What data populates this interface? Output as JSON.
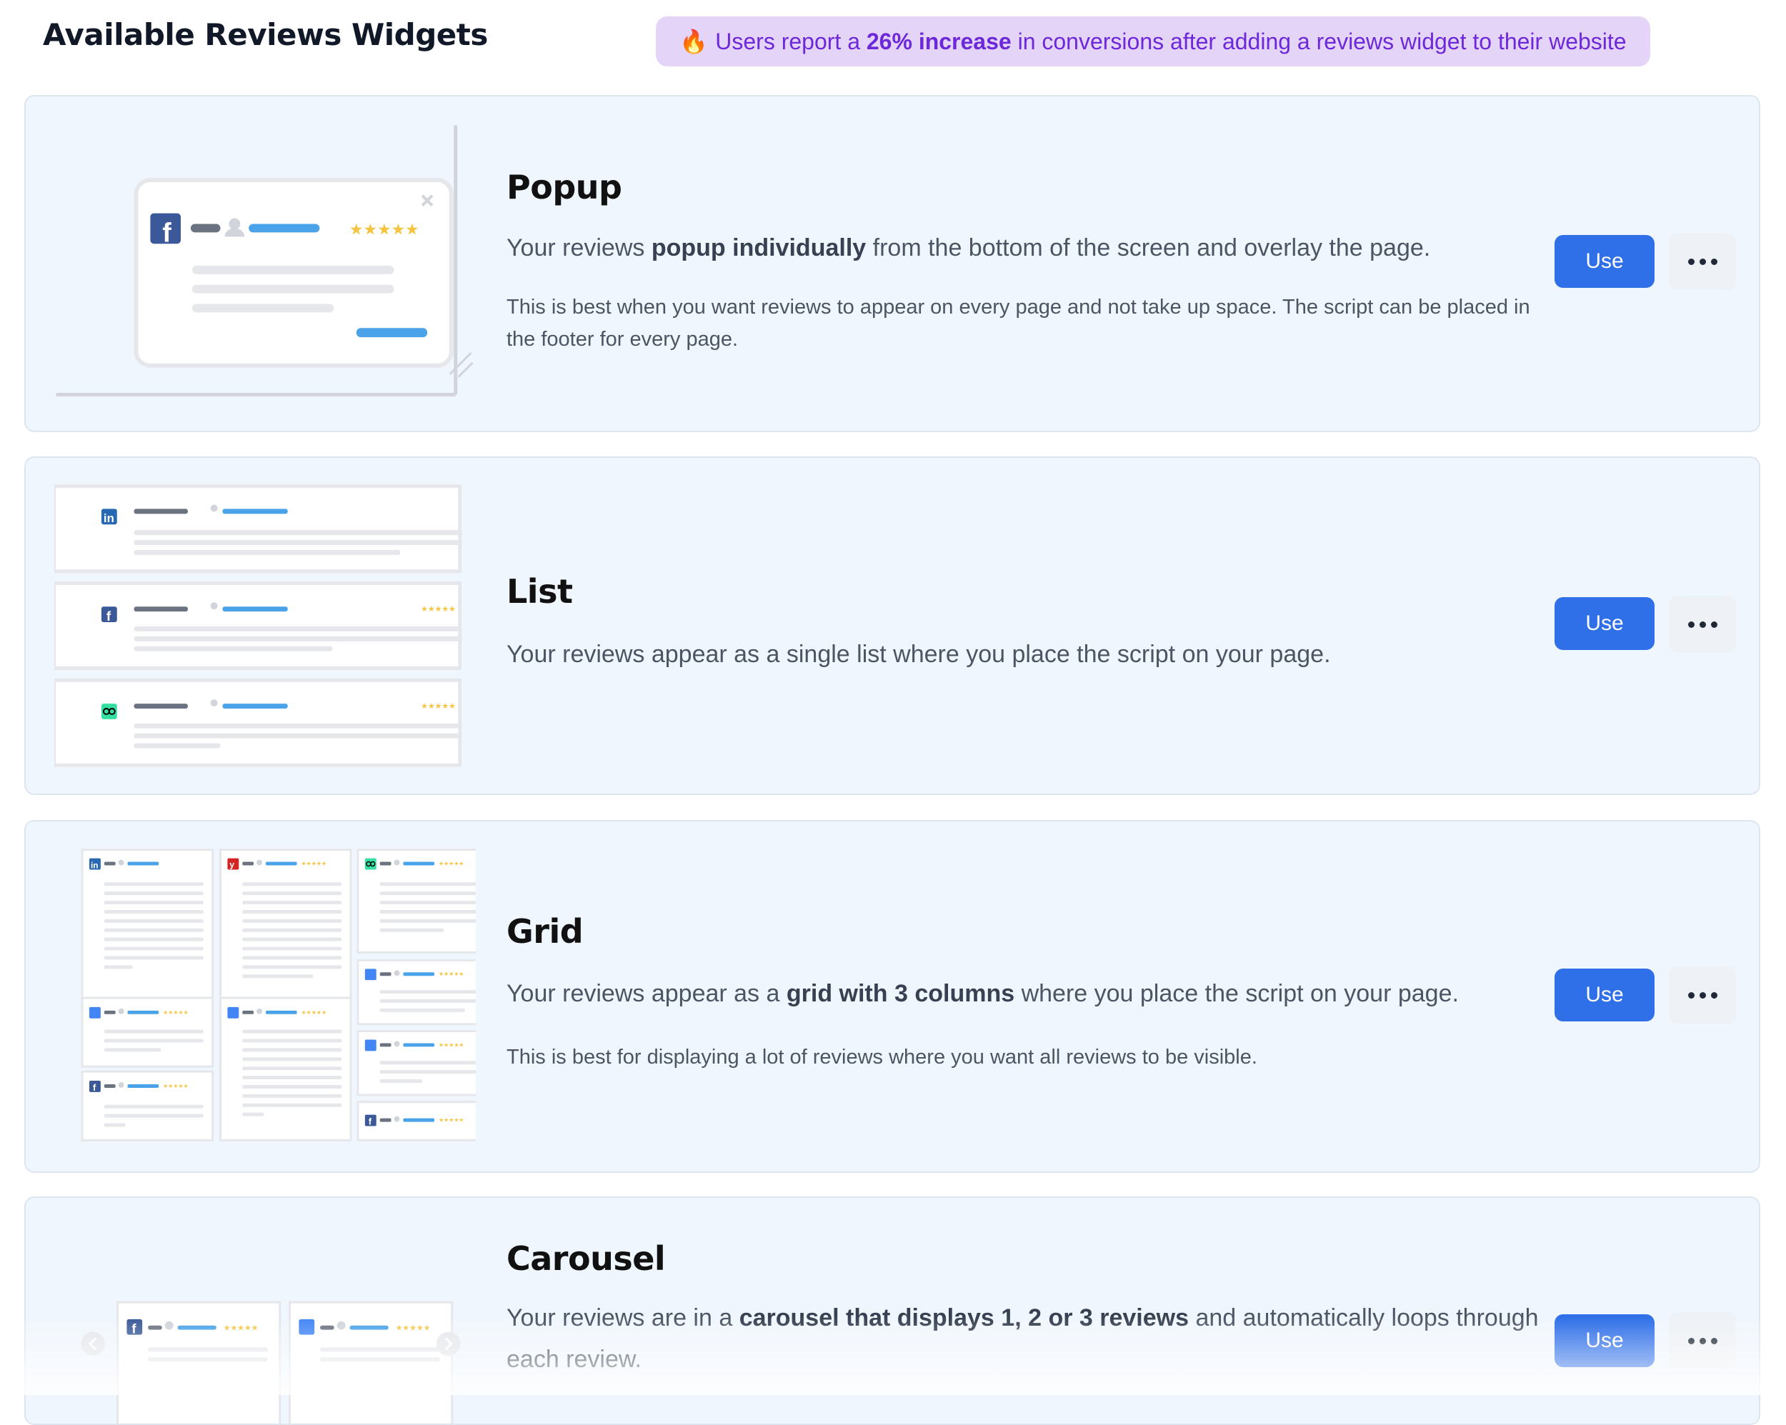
{
  "header": {
    "title": "Available Reviews Widgets",
    "promo": {
      "emoji": "🔥",
      "prefix": "Users report a",
      "highlight": "26% increase",
      "suffix": "in conversions after adding a reviews widget to their website"
    }
  },
  "widgets": [
    {
      "title": "Popup",
      "desc_pre": "Your reviews",
      "desc_bold": "popup individually",
      "desc_post": "from the bottom of the screen and overlay the page.",
      "note": "This is best when you want reviews to appear on every page and not take up space. The script can be placed in the footer for every page.",
      "use_label": "Use"
    },
    {
      "title": "List",
      "desc": "Your reviews appear as a single list where you place the script on your page.",
      "use_label": "Use"
    },
    {
      "title": "Grid",
      "desc_pre": "Your reviews appear as a",
      "desc_bold": "grid with 3 columns",
      "desc_post": "where you place the script on your page.",
      "note": "This is best for displaying a lot of reviews where you want all reviews to be visible.",
      "use_label": "Use"
    },
    {
      "title": "Carousel",
      "desc_pre": "Your reviews are in a",
      "desc_bold": "carousel that displays 1, 2 or 3 reviews",
      "desc_post": "and automatically loops through each review.",
      "use_label": "Use"
    }
  ],
  "icons": {
    "more": "more-horizontal-icon",
    "facebook": "facebook-icon",
    "linkedin": "linkedin-icon",
    "tripadvisor": "tripadvisor-icon",
    "yelp": "yelp-icon",
    "google-business": "google-business-icon",
    "user": "user-avatar-icon",
    "close": "close-icon",
    "resize": "resize-handle-icon",
    "chevron-left": "chevron-left-icon",
    "chevron-right": "chevron-right-icon"
  },
  "colors": {
    "accent": "#2f6fe8",
    "promo_bg": "#e4d4f8",
    "promo_text": "#6d28d9",
    "card_bg": "#f0f6fd",
    "star": "#f5c542",
    "facebook": "#3b5998",
    "linkedin": "#2867b2",
    "tripadvisor": "#34e0a1",
    "yelp": "#d32323"
  }
}
